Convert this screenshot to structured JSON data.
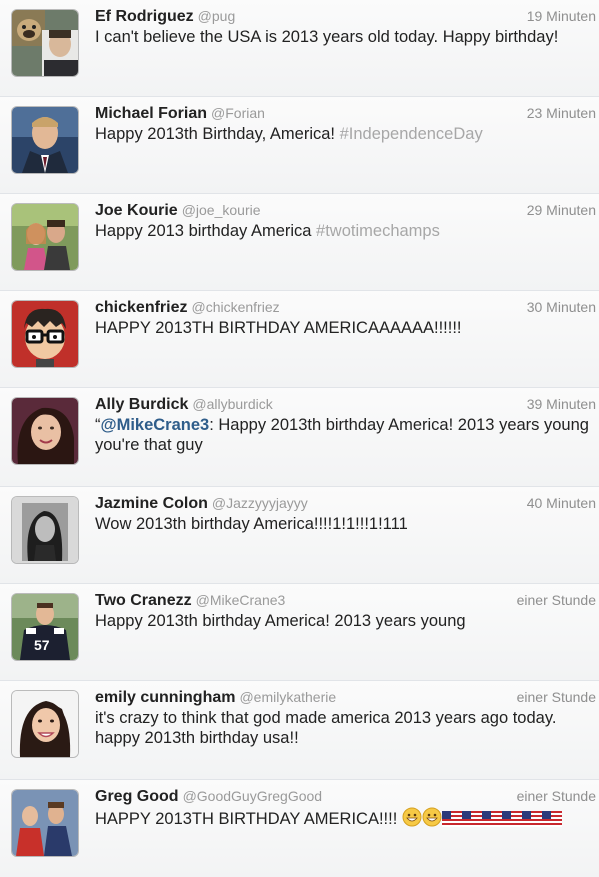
{
  "tweets": [
    {
      "name": "Ef Rodriguez",
      "handle": "@pug",
      "time": "19 Minuten",
      "text": "I can't believe the USA is 2013 years old today. Happy birthday!",
      "avatar": "pug-and-man-avatar"
    },
    {
      "name": "Michael Forian",
      "handle": "@Forian",
      "time": "23 Minuten",
      "text": "Happy 2013th Birthday, America! ",
      "hashtag": "#IndependenceDay",
      "avatar": "man-in-suit-avatar"
    },
    {
      "name": "Joe Kourie",
      "handle": "@joe_kourie",
      "time": "29 Minuten",
      "text": "Happy 2013 birthday America ",
      "hashtag": "#twotimechamps",
      "avatar": "couple-outdoors-avatar"
    },
    {
      "name": "chickenfriez",
      "handle": "@chickenfriez",
      "time": "30 Minuten",
      "text": "HAPPY 2013TH BIRTHDAY AMERICAAAAAA!!!!!!",
      "avatar": "cartoon-glasses-avatar"
    },
    {
      "name": "Ally Burdick",
      "handle": "@allyburdick",
      "time": "39 Minuten",
      "quote_open": "“",
      "mention": "@MikeCrane3",
      "text": ": Happy 2013th birthday America! 2013 years young you're that guy",
      "avatar": "girl-selfie-avatar"
    },
    {
      "name": "Jazmine Colon",
      "handle": "@Jazzyyyjayyy",
      "time": "40 Minuten",
      "text": "Wow 2013th birthday America!!!!1!1!!!1!111",
      "avatar": "bw-girl-avatar"
    },
    {
      "name": "Two Cranezz",
      "handle": "@MikeCrane3",
      "time": "einer Stunde",
      "text": "Happy 2013th birthday America! 2013 years young",
      "avatar": "football-player-avatar"
    },
    {
      "name": "emily cunningham",
      "handle": "@emilykatherie",
      "time": "einer Stunde",
      "text": "it's crazy to think that god made america 2013 years ago today. happy 2013th birthday usa!!",
      "avatar": "girl-smiling-avatar"
    },
    {
      "name": "Greg Good",
      "handle": "@GoodGuyGregGood",
      "time": "einer Stunde",
      "text": "HAPPY 2013TH BIRTHDAY AMERICA!!!! ",
      "avatar": "group-photo-avatar",
      "emojis": [
        "grinning-face-emoji",
        "grinning-face-emoji",
        "us-flag-emoji",
        "us-flag-emoji",
        "us-flag-emoji",
        "us-flag-emoji",
        "us-flag-emoji",
        "us-flag-emoji"
      ]
    }
  ],
  "colors": {
    "name": "#222222",
    "handle": "#9a9a9a",
    "time": "#8f8f8f",
    "hashtag": "#a7a7a7",
    "mention": "#2f5d8a",
    "divider": "#e1e4e8"
  }
}
